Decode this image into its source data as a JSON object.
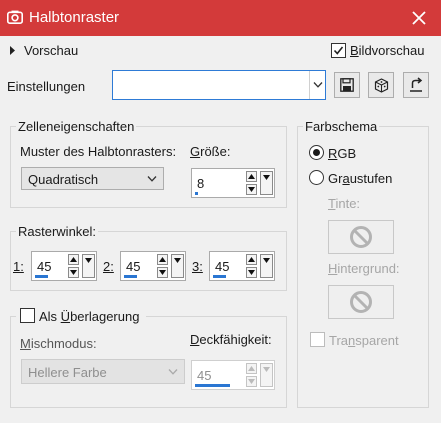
{
  "window": {
    "title": "Halbtonraster",
    "icon": "camera-icon",
    "close_icon": "close-icon",
    "accent": "#d33a3a"
  },
  "preview": {
    "toggle_label": "Vorschau",
    "checkbox_label": "Bildvorschau",
    "checked": true
  },
  "settings": {
    "label": "Einstellungen",
    "value": "",
    "buttons": [
      "save-icon",
      "dice-icon",
      "reset-icon"
    ]
  },
  "cell": {
    "title": "Zelleneigenschaften",
    "pattern_label": "Muster des Halbtonrasters:",
    "pattern_value": "Quadratisch",
    "size_label": "Größe:",
    "size_value": "8"
  },
  "angles": {
    "title": "Rasterwinkel:",
    "items": [
      {
        "label": "1:",
        "value": "45"
      },
      {
        "label": "2:",
        "value": "45"
      },
      {
        "label": "3:",
        "value": "45"
      }
    ]
  },
  "overlay": {
    "checkbox_label": "Als Überlagerung",
    "checked": false,
    "blend_label": "Mischmodus:",
    "blend_value": "Hellere Farbe",
    "opacity_label": "Deckfähigkeit:",
    "opacity_value": "45"
  },
  "color_scheme": {
    "title": "Farbschema",
    "options": [
      "RGB",
      "Graustufen"
    ],
    "selected": "RGB",
    "ink_label": "Tinte:",
    "background_label": "Hintergrund:",
    "transparent_label": "Transparent"
  }
}
